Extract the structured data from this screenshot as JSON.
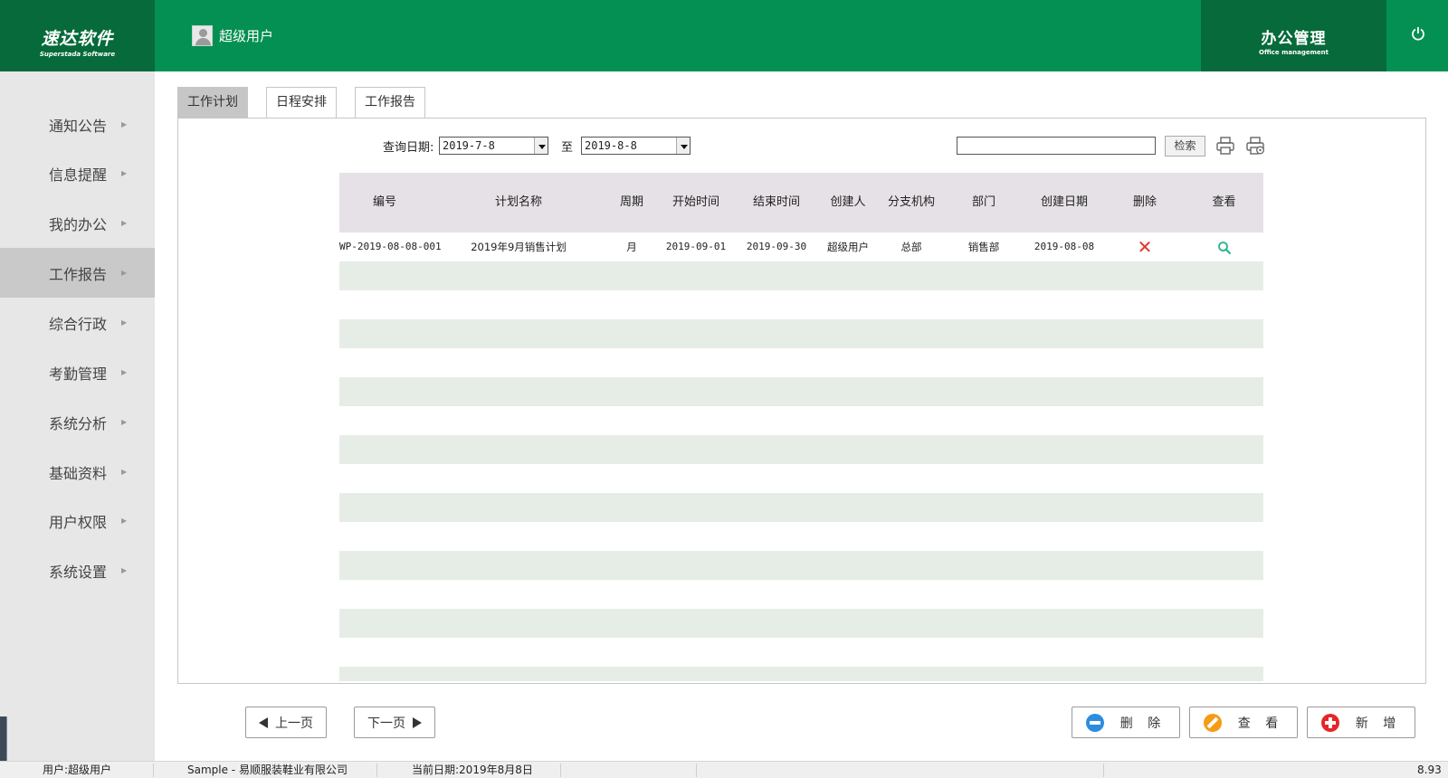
{
  "brand": {
    "cn": "速达软件",
    "en": "Superstada Software"
  },
  "header": {
    "user_name": "超级用户",
    "module_cn": "办公管理",
    "module_en": "Office management",
    "power_icon": "power-icon"
  },
  "sidebar": {
    "items": [
      {
        "label": "通知公告"
      },
      {
        "label": "信息提醒"
      },
      {
        "label": "我的办公"
      },
      {
        "label": "工作报告"
      },
      {
        "label": "综合行政"
      },
      {
        "label": "考勤管理"
      },
      {
        "label": "系统分析"
      },
      {
        "label": "基础资料"
      },
      {
        "label": "用户权限"
      },
      {
        "label": "系统设置"
      }
    ],
    "active": "工作报告"
  },
  "tabs": [
    {
      "label": "工作计划"
    },
    {
      "label": "日程安排"
    },
    {
      "label": "工作报告"
    }
  ],
  "query": {
    "date_label": "查询日期:",
    "from": "2019-7-8",
    "to_label": "至",
    "to": "2019-8-8",
    "search_value": "",
    "search_button": "检索"
  },
  "table": {
    "columns": [
      "编号",
      "计划名称",
      "周期",
      "开始时间",
      "结束时间",
      "创建人",
      "分支机构",
      "部门",
      "创建日期",
      "删除",
      "查看"
    ],
    "rows": [
      {
        "id": "WP-2019-08-08-001",
        "name": "2019年9月销售计划",
        "period": "月",
        "start": "2019-09-01",
        "end": "2019-09-30",
        "creator": "超级用户",
        "branch": "总部",
        "dept": "销售部",
        "created": "2019-08-08"
      }
    ]
  },
  "buttons": {
    "prev": "上一页",
    "next": "下一页",
    "delete": "删 除",
    "view": "查 看",
    "add": "新 增"
  },
  "status": {
    "user": "用户:超级用户",
    "company": "Sample - 易顺服装鞋业有限公司",
    "date": "当前日期:2019年8月8日",
    "version": "8.93"
  },
  "colors": {
    "header_green": "#049052",
    "dark_green": "#066a3a",
    "sidebar_bg": "#e7e7e7",
    "row_alt": "#e6ede6",
    "table_head": "#e6e1e6"
  }
}
